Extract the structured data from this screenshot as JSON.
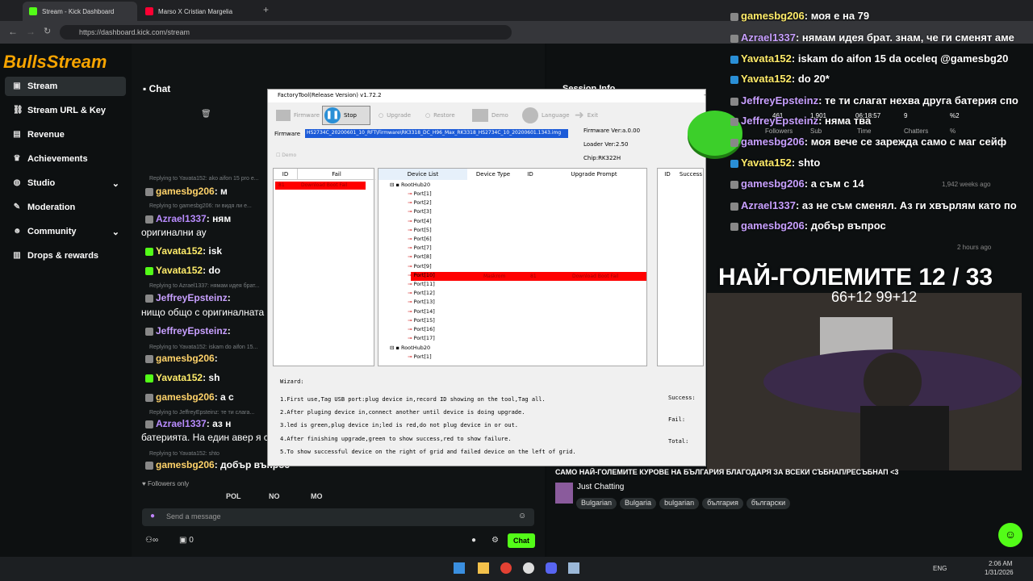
{
  "browser": {
    "tabs": [
      {
        "title": "Stream - Kick Dashboard"
      },
      {
        "title": "Marso X Cristian Margelia"
      }
    ],
    "url": "https://dashboard.kick.com/stream"
  },
  "sidebar": {
    "logo_text": "BullsStream",
    "items": [
      {
        "label": "Stream",
        "icon": "video-icon"
      },
      {
        "label": "Stream URL & Key",
        "icon": "link-icon"
      },
      {
        "label": "Revenue",
        "icon": "chart-icon"
      },
      {
        "label": "Achievements",
        "icon": "trophy-icon"
      },
      {
        "label": "Studio",
        "icon": "globe-icon"
      },
      {
        "label": "Moderation",
        "icon": "wrench-icon"
      },
      {
        "label": "Community",
        "icon": "community-icon"
      },
      {
        "label": "Drops & rewards",
        "icon": "gift-icon"
      }
    ]
  },
  "chat": {
    "title": "Chat",
    "followers_only": "Followers only",
    "input_placeholder": "Send a message",
    "send_label": "Chat",
    "viewer_count": "0",
    "quick_emotes": [
      "POL",
      "NO",
      "MO"
    ],
    "messages": [
      {
        "reply": "Replying to Yavata152: ako aifon 15 pro e...",
        "user": "gamesbg206",
        "text": "м"
      },
      {
        "reply": "Replying to gamesbg206: ги видя ли е...",
        "user": "Azrael1337",
        "text": "ням",
        "cont": "оригинални ау"
      },
      {
        "reply": "",
        "user": "Yavata152",
        "text": "isk"
      },
      {
        "reply": "",
        "user": "Yavata152",
        "text": "do"
      },
      {
        "reply": "Replying to Azrael1337: нямам идея брат...",
        "user": "JeffreyEpsteinz",
        "text": "",
        "cont": "нищо общо с оригиналната"
      },
      {
        "reply": "",
        "user": "JeffreyEpsteinz",
        "text": ""
      },
      {
        "reply": "Replying to Yavata152: iskam do aifon 15...",
        "user": "gamesbg206",
        "text": ""
      },
      {
        "reply": "",
        "user": "Yavata152",
        "text": "sh"
      },
      {
        "reply": "",
        "user": "gamesbg206",
        "text": "а с"
      },
      {
        "reply": "Replying to JeffreyEpsteinz: те ти слага...",
        "user": "Azrael1337",
        "text": "аз н",
        "cont": "батерията. На един авер я с"
      },
      {
        "reply": "Replying to Yavata152: shto",
        "user": "gamesbg206",
        "text": "добър въпрос"
      }
    ]
  },
  "factory_tool": {
    "title": "FactoryTool(Release Version) v1.72.2",
    "toolbar": [
      "Firmware",
      "Stop",
      "Upgrade",
      "Restore",
      "Demo",
      "Language",
      "Exit"
    ],
    "firmware_label": "Firmware",
    "firmware_path": "HS2734C_20200601_10_RFT\\Firmware\\RK3318_DC_H96_Max_RK3318_HS2734C_10_20200601.1343.img",
    "firmware_ver": "Firmware Ver:a.0.00",
    "loader_ver": "Loader Ver:2.50",
    "chip": "Chip:RK322H",
    "demo_label": "Demo",
    "fail_headers": [
      "ID",
      "Fail"
    ],
    "fail_row": [
      "81",
      "Download Boot Fail"
    ],
    "device_headers": [
      "Device List",
      "Device Type",
      "ID",
      "Upgrade Prompt"
    ],
    "success_headers": [
      "ID",
      "Success"
    ],
    "roothub1": "RootHub20",
    "ports": [
      "Port[1]",
      "Port[2]",
      "Port[3]",
      "Port[4]",
      "Port[5]",
      "Port[6]",
      "Port[7]",
      "Port[8]",
      "Port[9]",
      "Port[10]",
      "Port[11]",
      "Port[12]",
      "Port[13]",
      "Port[14]",
      "Port[15]",
      "Port[16]",
      "Port[17]"
    ],
    "port10_row": [
      "Maskrom",
      "81",
      "Download Boot Fail"
    ],
    "roothub2": "RootHub20",
    "roothub2_port": "Port[1]",
    "wizard_title": "Wizard:",
    "wizard_lines": [
      "1.First use,Tag USB port:plug device in,record ID showing on the tool,Tag all.",
      "2.After pluging device in,connect another until device is doing upgrade.",
      "3.led is green,plug device in;led is red,do not plug device in or out.",
      "4.After finishing upgrade,green to show success,red to show failure.",
      "5.To show successful device on the right of grid and failed device on the left of grid."
    ],
    "success_label": "Success:",
    "fail_label": "Fail:",
    "total_label": "Total:"
  },
  "session": {
    "title": "Session Info",
    "stats": [
      "461",
      "1,901",
      "9",
      "%2"
    ],
    "stat_labels": [
      "Followers",
      "Sub",
      "Time",
      "Chatters",
      "%"
    ],
    "time": "06:18:57",
    "ago1": "1,942 weeks ago",
    "ago2": "2 hours ago",
    "stream_title": "САМО НАЙ-ГОЛЕМИТЕ КУРОВЕ НА БЪЛГАРИЯ БЛАГОДАРЯ ЗА ВСЕКИ СЪБНАП/РЕСЪБНАП <3",
    "category": "Just Chatting",
    "tags": [
      "Bulgarian",
      "Bulgaria",
      "bulgarian",
      "българия",
      "български"
    ]
  },
  "overlay": {
    "messages": [
      {
        "user": "gamesbg206",
        "text": ": моя е на 79"
      },
      {
        "user": "Azrael1337",
        "text": ": нямам идея брат. знам, че ги сменят аме"
      },
      {
        "user": "Yavata152",
        "text": ": iskam do aifon 15 da oceleq @gamesbg20"
      },
      {
        "user": "Yavata152",
        "text": ": do 20*"
      },
      {
        "user": "JeffreyEpsteinz",
        "text": ": те ти слагат нехва друга батерия спо"
      },
      {
        "user": "JeffreyEpsteinz",
        "text": ": няма тва"
      },
      {
        "user": "gamesbg206",
        "text": ": моя вече се зарежда само с маг сейф"
      },
      {
        "user": "Yavata152",
        "text": ": shto"
      },
      {
        "user": "gamesbg206",
        "text": ": а съм с 14"
      },
      {
        "user": "Azrael1337",
        "text": ": аз не съм сменял. Аз ги хвърлям като по"
      },
      {
        "user": "gamesbg206",
        "text": ": добър въпрос"
      }
    ],
    "goal_title": "НАЙ-ГОЛЕМИТЕ 12 / 33",
    "goal_sub": "66+12 99+12"
  },
  "taskbar": {
    "lang": "ENG",
    "time": "2:06 AM",
    "date": "1/31/2026"
  },
  "colors": {
    "kick_green": "#53fc18",
    "fail_red": "#ff0000"
  }
}
